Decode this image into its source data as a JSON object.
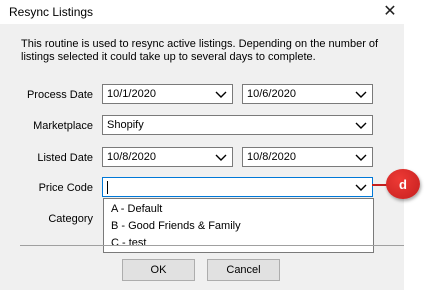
{
  "window": {
    "title": "Resync Listings",
    "close_glyph": "✕"
  },
  "description": "This routine is used to resync active listings. Depending on the number of listings selected it could take up to several days to complete.",
  "form": {
    "process_date": {
      "label": "Process Date",
      "from": "10/1/2020",
      "to": "10/6/2020"
    },
    "marketplace": {
      "label": "Marketplace",
      "value": "Shopify"
    },
    "listed_date": {
      "label": "Listed Date",
      "from": "10/8/2020",
      "to": "10/8/2020"
    },
    "price_code": {
      "label": "Price Code",
      "value": "",
      "options": [
        "A - Default",
        "B - Good Friends & Family",
        "C - test"
      ]
    },
    "category": {
      "label": "Category"
    }
  },
  "buttons": {
    "ok": "OK",
    "cancel": "Cancel"
  },
  "annotation": {
    "callout_label": "d",
    "color": "#c41f1f"
  },
  "colors": {
    "focus_border": "#0078d7",
    "dialog_bg": "#f0f0f0"
  },
  "icons": {
    "dropdown": "chevron-down-icon",
    "close": "close-icon"
  }
}
